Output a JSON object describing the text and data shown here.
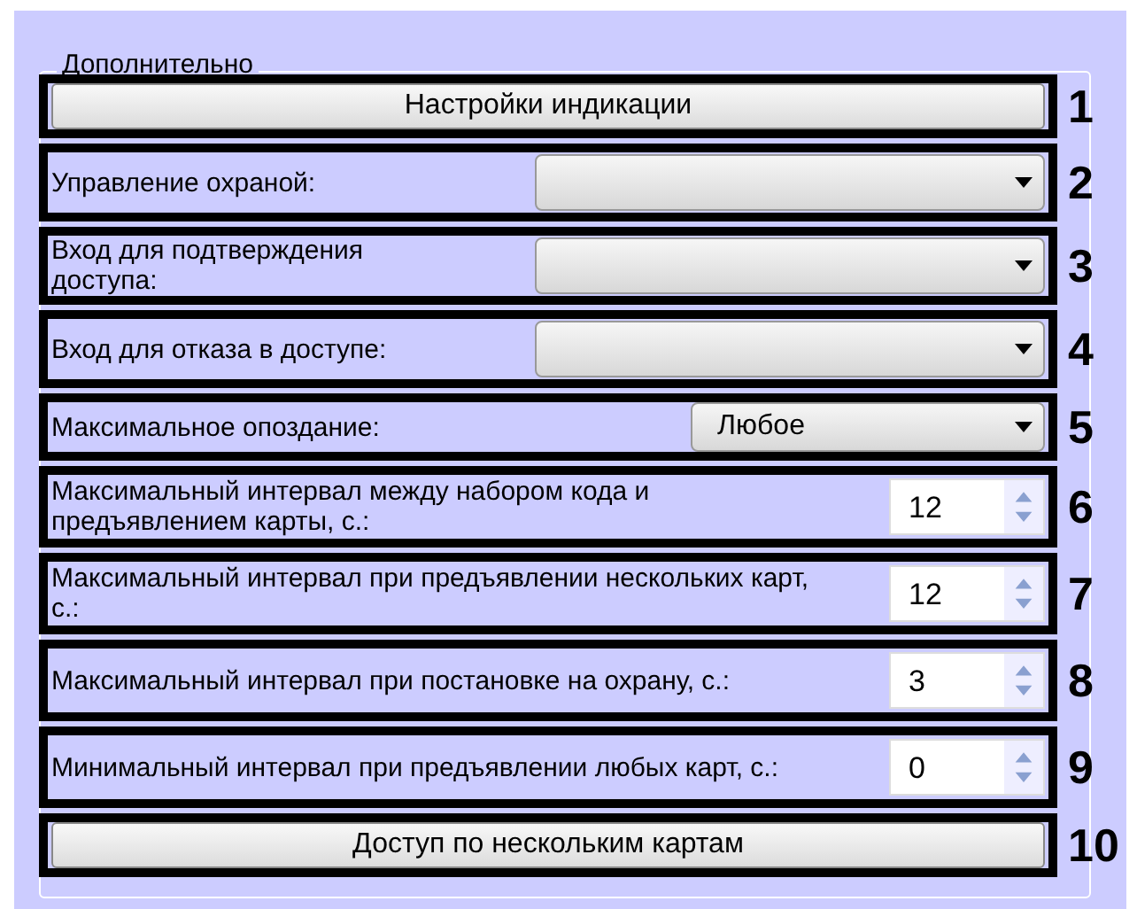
{
  "group": {
    "title": "Дополнительно"
  },
  "rows": [
    {
      "kind": "button",
      "label": "Настройки индикации",
      "callout": "1"
    },
    {
      "kind": "dropdown",
      "label": "Управление охраной:",
      "value": "",
      "callout": "2"
    },
    {
      "kind": "dropdown",
      "label": "Вход для подтверждения доступа:",
      "value": "",
      "callout": "3"
    },
    {
      "kind": "dropdown",
      "label": "Вход для отказа в доступе:",
      "value": "",
      "callout": "4"
    },
    {
      "kind": "dropdown-narrow",
      "label": "Максимальное опоздание:",
      "value": "Любое",
      "callout": "5"
    },
    {
      "kind": "spinner",
      "label": "Максимальный интервал между набором кода и предъявлением карты, с.:",
      "value": "12",
      "callout": "6"
    },
    {
      "kind": "spinner",
      "label": "Максимальный интервал при предъявлении нескольких карт, с.:",
      "value": "12",
      "callout": "7"
    },
    {
      "kind": "spinner",
      "label": "Максимальный интервал при постановке на охрану, с.:",
      "value": "3",
      "callout": "8"
    },
    {
      "kind": "spinner",
      "label": "Минимальный интервал при предъявлении любых карт, с.:",
      "value": "0",
      "callout": "9"
    },
    {
      "kind": "button",
      "label": "Доступ по нескольким картам",
      "callout": "10"
    }
  ]
}
